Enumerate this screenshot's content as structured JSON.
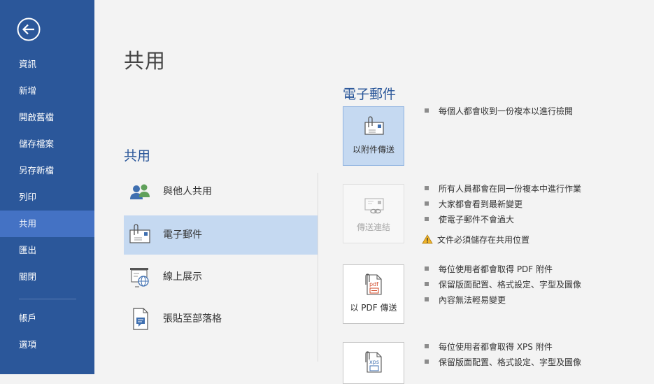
{
  "sidebar": {
    "back_icon": "back-arrow-icon",
    "items": [
      {
        "label": "資訊"
      },
      {
        "label": "新增"
      },
      {
        "label": "開啟舊檔"
      },
      {
        "label": "儲存檔案"
      },
      {
        "label": "另存新檔"
      },
      {
        "label": "列印"
      },
      {
        "label": "共用",
        "active": true
      },
      {
        "label": "匯出"
      },
      {
        "label": "關閉"
      },
      {
        "label": "帳戶"
      },
      {
        "label": "選項"
      }
    ]
  },
  "main": {
    "page_title": "共用",
    "section_title": "共用",
    "share_options": [
      {
        "label": "與他人共用",
        "icon": "people-icon"
      },
      {
        "label": "電子郵件",
        "icon": "email-icon",
        "active": true
      },
      {
        "label": "線上展示",
        "icon": "present-online-icon"
      },
      {
        "label": "張貼至部落格",
        "icon": "blog-post-icon"
      }
    ]
  },
  "email_panel": {
    "title": "電子郵件",
    "options": [
      {
        "label": "以附件傳送",
        "icon": "attachment-envelope-icon",
        "state": "selected",
        "bullets": [
          "每個人都會收到一份複本以進行檢閱"
        ]
      },
      {
        "label": "傳送連結",
        "icon": "link-envelope-icon",
        "state": "disabled",
        "bullets": [
          "所有人員都會在同一份複本中進行作業",
          "大家都會看到最新變更",
          "使電子郵件不會過大"
        ],
        "warning": "文件必須儲存在共用位置"
      },
      {
        "label": "以 PDF 傳送",
        "icon": "pdf-attachment-icon",
        "state": "normal",
        "bullets": [
          "每位使用者都會取得 PDF 附件",
          "保留版面配置、格式設定、字型及圖像",
          "內容無法輕易變更"
        ]
      },
      {
        "label": "",
        "icon": "xps-attachment-icon",
        "state": "normal",
        "bullets": [
          "每位使用者都會取得 XPS 附件",
          "保留版面配置、格式設定、字型及圖像"
        ]
      }
    ]
  },
  "colors": {
    "sidebar_bg": "#2b579a",
    "sidebar_active": "#4472c4",
    "accent": "#2b579a",
    "selected_bg": "#c5d9f1"
  }
}
